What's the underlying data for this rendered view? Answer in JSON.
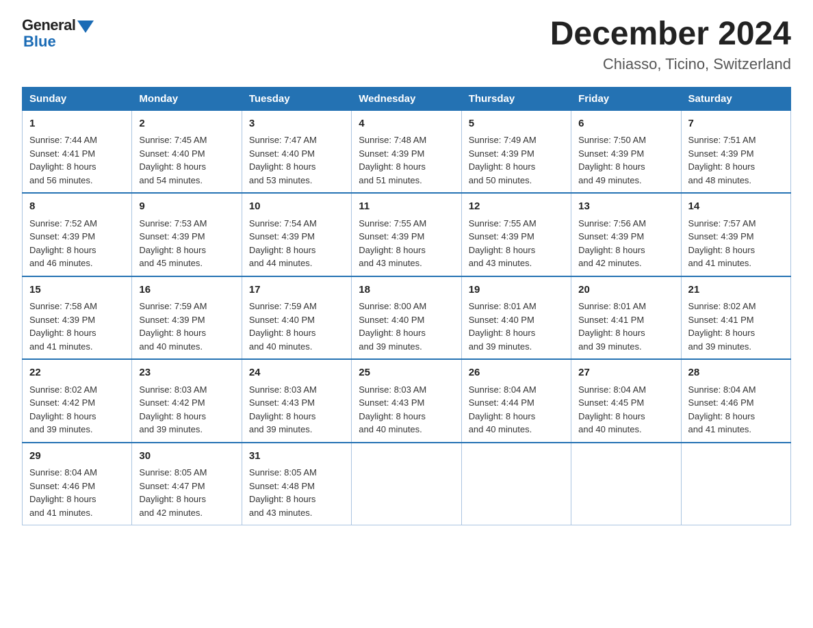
{
  "logo": {
    "general": "General",
    "blue": "Blue"
  },
  "title": "December 2024",
  "location": "Chiasso, Ticino, Switzerland",
  "days_of_week": [
    "Sunday",
    "Monday",
    "Tuesday",
    "Wednesday",
    "Thursday",
    "Friday",
    "Saturday"
  ],
  "weeks": [
    [
      {
        "day": "1",
        "sunrise": "7:44 AM",
        "sunset": "4:41 PM",
        "daylight": "8 hours and 56 minutes."
      },
      {
        "day": "2",
        "sunrise": "7:45 AM",
        "sunset": "4:40 PM",
        "daylight": "8 hours and 54 minutes."
      },
      {
        "day": "3",
        "sunrise": "7:47 AM",
        "sunset": "4:40 PM",
        "daylight": "8 hours and 53 minutes."
      },
      {
        "day": "4",
        "sunrise": "7:48 AM",
        "sunset": "4:39 PM",
        "daylight": "8 hours and 51 minutes."
      },
      {
        "day": "5",
        "sunrise": "7:49 AM",
        "sunset": "4:39 PM",
        "daylight": "8 hours and 50 minutes."
      },
      {
        "day": "6",
        "sunrise": "7:50 AM",
        "sunset": "4:39 PM",
        "daylight": "8 hours and 49 minutes."
      },
      {
        "day": "7",
        "sunrise": "7:51 AM",
        "sunset": "4:39 PM",
        "daylight": "8 hours and 48 minutes."
      }
    ],
    [
      {
        "day": "8",
        "sunrise": "7:52 AM",
        "sunset": "4:39 PM",
        "daylight": "8 hours and 46 minutes."
      },
      {
        "day": "9",
        "sunrise": "7:53 AM",
        "sunset": "4:39 PM",
        "daylight": "8 hours and 45 minutes."
      },
      {
        "day": "10",
        "sunrise": "7:54 AM",
        "sunset": "4:39 PM",
        "daylight": "8 hours and 44 minutes."
      },
      {
        "day": "11",
        "sunrise": "7:55 AM",
        "sunset": "4:39 PM",
        "daylight": "8 hours and 43 minutes."
      },
      {
        "day": "12",
        "sunrise": "7:55 AM",
        "sunset": "4:39 PM",
        "daylight": "8 hours and 43 minutes."
      },
      {
        "day": "13",
        "sunrise": "7:56 AM",
        "sunset": "4:39 PM",
        "daylight": "8 hours and 42 minutes."
      },
      {
        "day": "14",
        "sunrise": "7:57 AM",
        "sunset": "4:39 PM",
        "daylight": "8 hours and 41 minutes."
      }
    ],
    [
      {
        "day": "15",
        "sunrise": "7:58 AM",
        "sunset": "4:39 PM",
        "daylight": "8 hours and 41 minutes."
      },
      {
        "day": "16",
        "sunrise": "7:59 AM",
        "sunset": "4:39 PM",
        "daylight": "8 hours and 40 minutes."
      },
      {
        "day": "17",
        "sunrise": "7:59 AM",
        "sunset": "4:40 PM",
        "daylight": "8 hours and 40 minutes."
      },
      {
        "day": "18",
        "sunrise": "8:00 AM",
        "sunset": "4:40 PM",
        "daylight": "8 hours and 39 minutes."
      },
      {
        "day": "19",
        "sunrise": "8:01 AM",
        "sunset": "4:40 PM",
        "daylight": "8 hours and 39 minutes."
      },
      {
        "day": "20",
        "sunrise": "8:01 AM",
        "sunset": "4:41 PM",
        "daylight": "8 hours and 39 minutes."
      },
      {
        "day": "21",
        "sunrise": "8:02 AM",
        "sunset": "4:41 PM",
        "daylight": "8 hours and 39 minutes."
      }
    ],
    [
      {
        "day": "22",
        "sunrise": "8:02 AM",
        "sunset": "4:42 PM",
        "daylight": "8 hours and 39 minutes."
      },
      {
        "day": "23",
        "sunrise": "8:03 AM",
        "sunset": "4:42 PM",
        "daylight": "8 hours and 39 minutes."
      },
      {
        "day": "24",
        "sunrise": "8:03 AM",
        "sunset": "4:43 PM",
        "daylight": "8 hours and 39 minutes."
      },
      {
        "day": "25",
        "sunrise": "8:03 AM",
        "sunset": "4:43 PM",
        "daylight": "8 hours and 40 minutes."
      },
      {
        "day": "26",
        "sunrise": "8:04 AM",
        "sunset": "4:44 PM",
        "daylight": "8 hours and 40 minutes."
      },
      {
        "day": "27",
        "sunrise": "8:04 AM",
        "sunset": "4:45 PM",
        "daylight": "8 hours and 40 minutes."
      },
      {
        "day": "28",
        "sunrise": "8:04 AM",
        "sunset": "4:46 PM",
        "daylight": "8 hours and 41 minutes."
      }
    ],
    [
      {
        "day": "29",
        "sunrise": "8:04 AM",
        "sunset": "4:46 PM",
        "daylight": "8 hours and 41 minutes."
      },
      {
        "day": "30",
        "sunrise": "8:05 AM",
        "sunset": "4:47 PM",
        "daylight": "8 hours and 42 minutes."
      },
      {
        "day": "31",
        "sunrise": "8:05 AM",
        "sunset": "4:48 PM",
        "daylight": "8 hours and 43 minutes."
      },
      null,
      null,
      null,
      null
    ]
  ],
  "labels": {
    "sunrise": "Sunrise: ",
    "sunset": "Sunset: ",
    "daylight": "Daylight: "
  }
}
